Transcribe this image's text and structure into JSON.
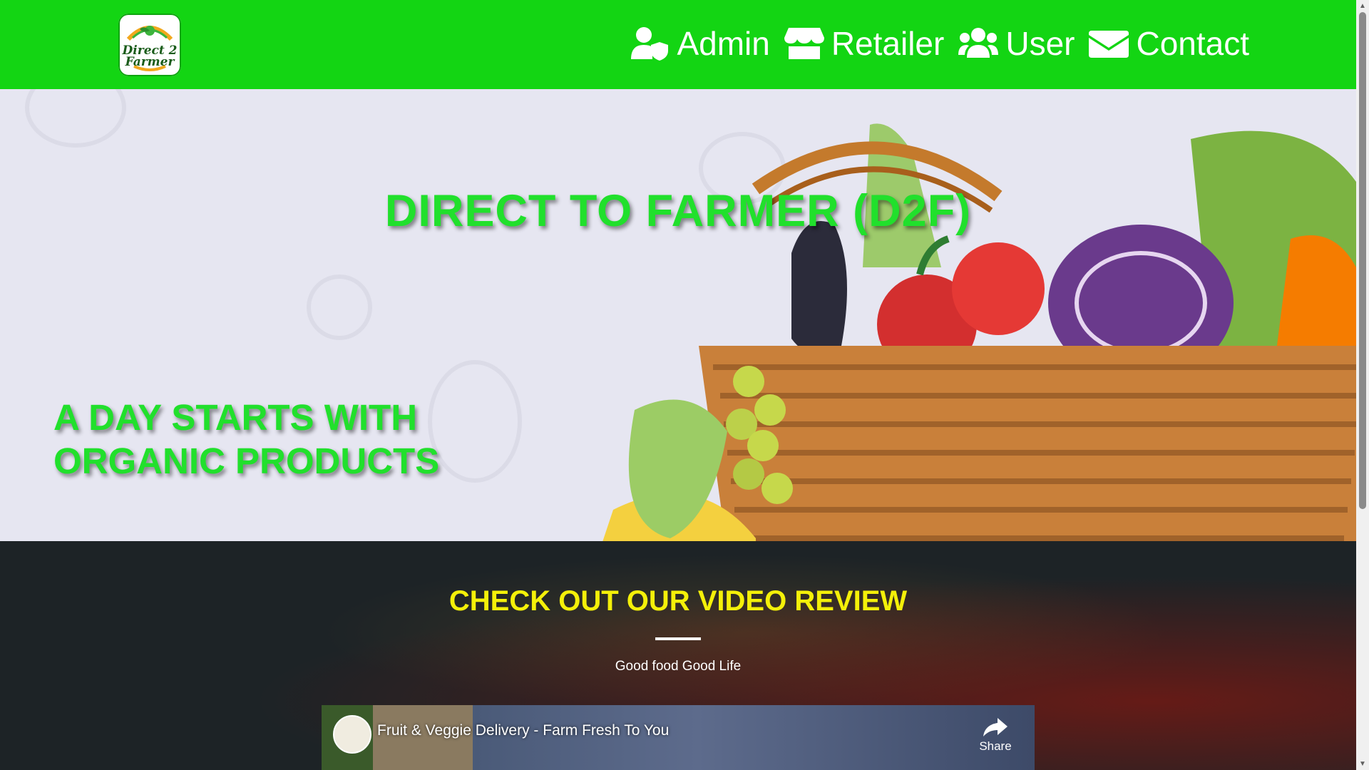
{
  "brand": {
    "logo_line1": "Direct 2",
    "logo_line2": "Farmer"
  },
  "nav": {
    "items": [
      {
        "label": "Admin",
        "icon": "user-shield-icon"
      },
      {
        "label": "Retailer",
        "icon": "store-icon"
      },
      {
        "label": "User",
        "icon": "users-icon"
      },
      {
        "label": "Contact",
        "icon": "envelope-icon"
      }
    ]
  },
  "hero": {
    "title": "DIRECT TO FARMER (D2F)",
    "subtitle_line1": "A DAY STARTS WITH",
    "subtitle_line2": "ORGANIC PRODUCTS"
  },
  "video_section": {
    "title": "CHECK OUT OUR VIDEO REVIEW",
    "subtitle": "Good food Good Life",
    "video": {
      "title": "Fruit & Veggie Delivery - Farm Fresh To You",
      "share_label": "Share"
    }
  },
  "colors": {
    "nav_bg": "#13d513",
    "hero_text": "#21e02c",
    "section_title": "#f4f009",
    "section_bg": "#1d2326"
  }
}
